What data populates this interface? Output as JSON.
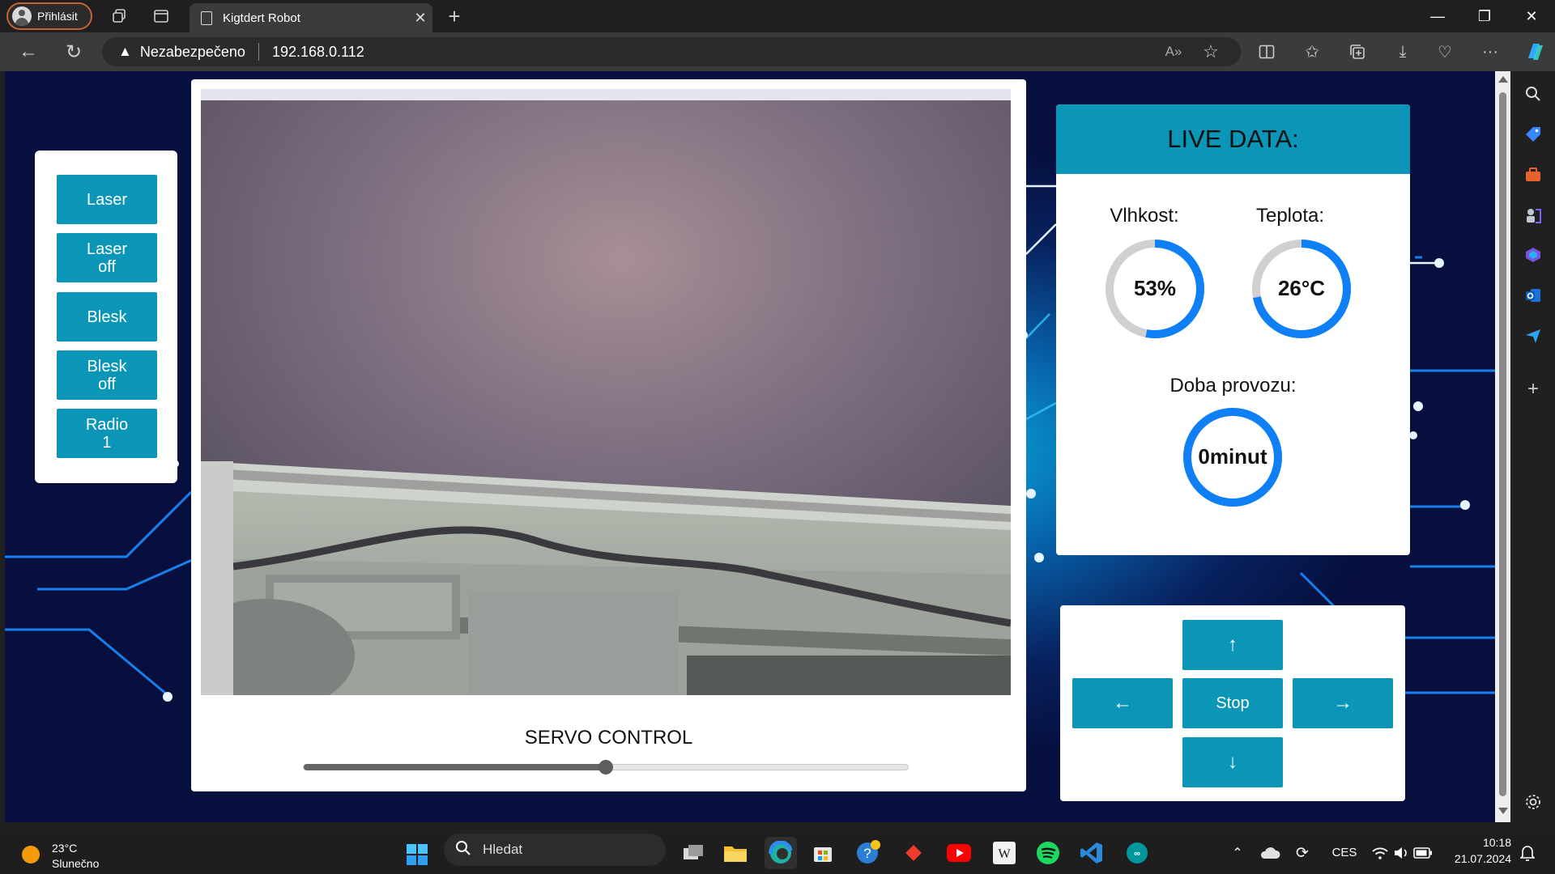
{
  "browser": {
    "profile_label": "Přihlásit",
    "tab_title": "Kigtdert Robot",
    "security_label": "Nezabezpečeno",
    "url": "192.168.0.112",
    "icons": [
      "back-icon",
      "reload-icon",
      "read-aloud-icon",
      "favorite-star-icon",
      "split-screen-icon",
      "favorites-icon",
      "collections-icon",
      "downloads-icon",
      "performance-icon",
      "more-icon",
      "copilot-icon"
    ]
  },
  "left_panel": {
    "buttons": [
      {
        "label": "Laser"
      },
      {
        "label": "Laser\noff"
      },
      {
        "label": "Blesk"
      },
      {
        "label": "Blesk\noff"
      },
      {
        "label": "Radio\n1"
      }
    ]
  },
  "camera": {
    "servo_title": "SERVO CONTROL",
    "servo_value": 0.5
  },
  "live_data": {
    "title": "LIVE DATA:",
    "humidity": {
      "label": "Vlhkost:",
      "value": "53%",
      "fraction": 0.53
    },
    "temperature": {
      "label": "Teplota:",
      "value": "26°C",
      "fraction": 0.72
    },
    "uptime": {
      "label": "Doba provozu:",
      "value": "0minut",
      "fraction": 1.0
    }
  },
  "dpad": {
    "up": "↑",
    "left": "←",
    "stop": "Stop",
    "right": "→",
    "down": "↓"
  },
  "taskbar": {
    "weather_temp": "23°C",
    "weather_desc": "Slunečno",
    "search_placeholder": "Hledat",
    "language": "CES",
    "time": "10:18",
    "date": "21.07.2024"
  },
  "colors": {
    "accent_teal": "#0b96b7",
    "gauge_blue": "#0f7ff5",
    "gauge_track": "#d0d0d0"
  }
}
